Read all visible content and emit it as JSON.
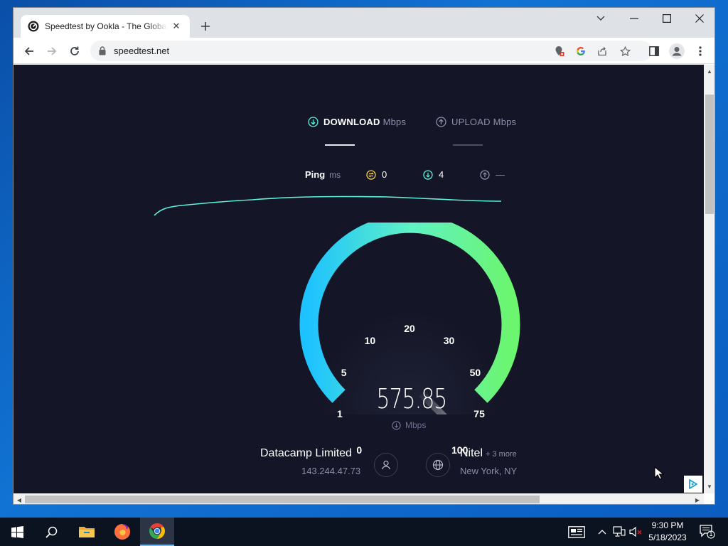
{
  "browser": {
    "tab_title": "Speedtest by Ookla - The Global Broadband Speed Test",
    "url": "speedtest.net",
    "tab_close_glyph": "✕",
    "new_tab_glyph": "+"
  },
  "speedtest": {
    "download_label": "DOWNLOAD",
    "upload_label": "UPLOAD",
    "unit": "Mbps",
    "ping_label": "Ping",
    "ping_unit": "ms",
    "ping_value": "0",
    "download_latency": "4",
    "upload_latency": "—",
    "gauge_ticks": [
      "0",
      "1",
      "5",
      "10",
      "20",
      "30",
      "50",
      "75",
      "100"
    ],
    "current_speed": "575.85",
    "needle_level": 1.0,
    "isp_name": "Datacamp Limited",
    "ip_address": "143.244.47.73",
    "server_name": "Nitel",
    "server_more": "+ 3 more",
    "server_location": "New York, NY",
    "colors": {
      "background": "#141526",
      "gauge_start": "#1ec2ff",
      "gauge_mid": "#5ff2c5",
      "gauge_end": "#6cf56f",
      "download_accent": "#5ff2dd",
      "ping_accent": "#f5d34a"
    }
  },
  "taskbar": {
    "time": "9:30 PM",
    "date": "5/18/2023",
    "notification_count": "1",
    "apps": [
      "start-icon",
      "search-icon",
      "file-explorer-icon",
      "firefox-icon",
      "chrome-icon"
    ]
  }
}
